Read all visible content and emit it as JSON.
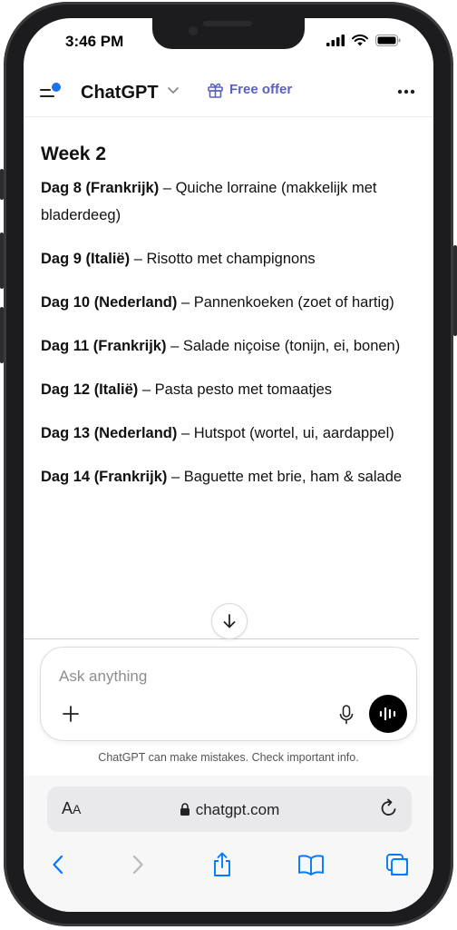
{
  "status_bar": {
    "time": "3:46 PM"
  },
  "header": {
    "app_title": "ChatGPT",
    "free_offer_label": "Free offer"
  },
  "content": {
    "heading": "Week 2",
    "meals": [
      {
        "day": "Dag 8 (Frankrijk)",
        "dish": " – Quiche lorraine (makkelijk met bladerdeeg)"
      },
      {
        "day": "Dag 9 (Italië)",
        "dish": " – Risotto met champignons"
      },
      {
        "day": "Dag 10 (Nederland)",
        "dish": " – Pannenkoeken (zoet of hartig)"
      },
      {
        "day": "Dag 11 (Frankrijk)",
        "dish": " – Salade niçoise (tonijn, ei, bonen)"
      },
      {
        "day": "Dag 12 (Italië)",
        "dish": " – Pasta pesto met tomaatjes"
      },
      {
        "day": "Dag 13 (Nederland)",
        "dish": " – Hutspot (wortel, ui, aardappel)"
      },
      {
        "day": "Dag 14 (Frankrijk)",
        "dish": " – Baguette met brie, ham & salade"
      }
    ]
  },
  "composer": {
    "placeholder": "Ask anything",
    "disclaimer": "ChatGPT can make mistakes. Check important info."
  },
  "browser": {
    "aa_label_large": "A",
    "aa_label_small": "A",
    "url": "chatgpt.com"
  },
  "colors": {
    "accent_blue": "#1a73e8",
    "free_offer": "#5b5fc7",
    "ios_blue": "#007aff"
  },
  "icons": [
    "menu-icon",
    "chevron-down-icon",
    "gift-icon",
    "more-icon",
    "arrow-down-icon",
    "plus-icon",
    "mic-icon",
    "voice-icon",
    "lock-icon",
    "reload-icon",
    "back-icon",
    "forward-icon",
    "share-icon",
    "bookmarks-icon",
    "tabs-icon"
  ]
}
